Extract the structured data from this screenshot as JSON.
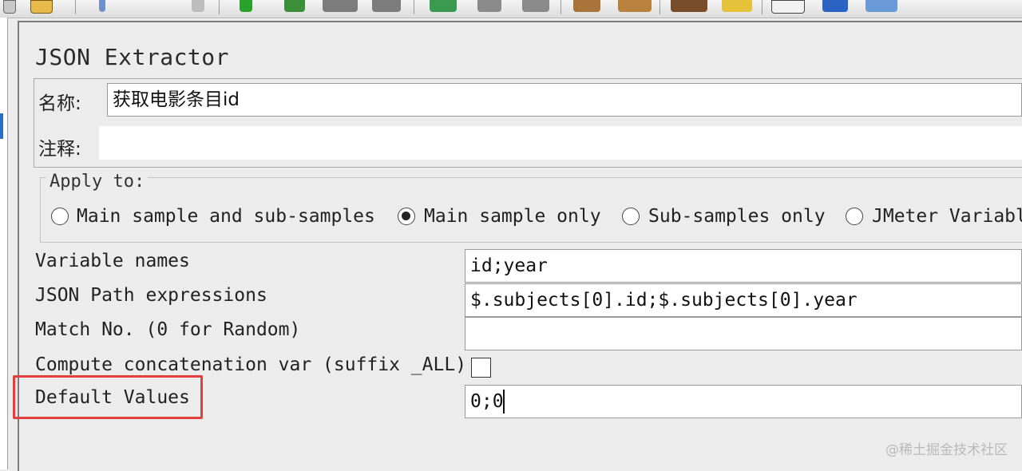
{
  "window": {
    "title": "JSON Extractor"
  },
  "form": {
    "name_label": "名称:",
    "name_value": "获取电影条目id",
    "comment_label": "注释:",
    "comment_value": ""
  },
  "apply_to": {
    "legend": "Apply to:",
    "options": [
      {
        "label": "Main sample and sub-samples",
        "selected": false
      },
      {
        "label": "Main sample only",
        "selected": true
      },
      {
        "label": "Sub-samples only",
        "selected": false
      },
      {
        "label": "JMeter Variabl",
        "selected": false
      }
    ]
  },
  "fields": {
    "variable_names_label": "Variable names",
    "variable_names_value": "id;year",
    "json_path_label": "JSON Path expressions",
    "json_path_value": "$.subjects[0].id;$.subjects[0].year",
    "match_no_label": "Match No. (0 for Random)",
    "match_no_value": "",
    "compute_concat_label": "Compute concatenation var (suffix _ALL)",
    "compute_concat_checked": false,
    "default_values_label": "Default Values",
    "default_values_value": "0;0"
  },
  "watermark": "@稀土掘金技术社区",
  "colors": {
    "highlight_border": "#e2403c",
    "panel_bg": "#ececec",
    "field_bg": "#ffffff"
  },
  "toolbar_icons": [
    "file-icon",
    "pencil-icon",
    "play-icon",
    "play-no-pause-icon",
    "stop-icon",
    "shutdown-icon",
    "remote-start-icon",
    "remote-stop-icon",
    "remote-shutdown-icon",
    "broom-icon",
    "broom-all-icon",
    "binoculars-icon",
    "reset-search-icon",
    "function-helper-icon",
    "help-icon",
    "remote-icon"
  ]
}
